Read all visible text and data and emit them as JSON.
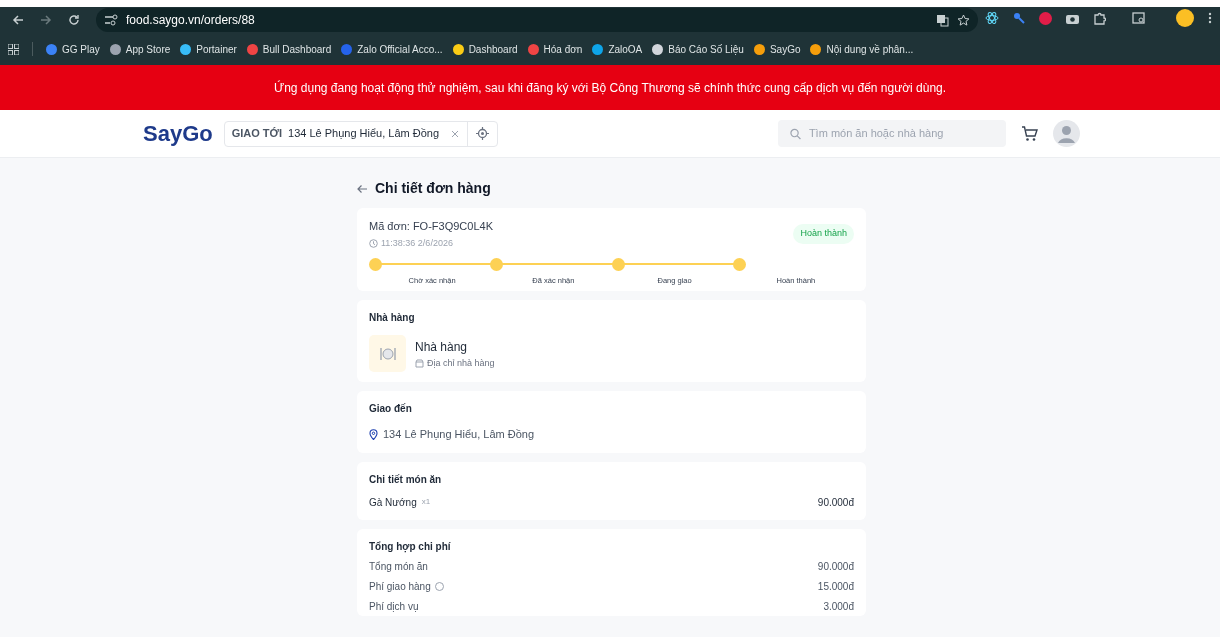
{
  "browser": {
    "url": "food.saygo.vn/orders/88",
    "bookmarks": [
      {
        "label": "GG Play",
        "color": "#3b82f6"
      },
      {
        "label": "App Store",
        "color": "#9ca3af"
      },
      {
        "label": "Portainer",
        "color": "#38bdf8"
      },
      {
        "label": "Bull Dashboard",
        "color": "#ef4444"
      },
      {
        "label": "Zalo Official Acco...",
        "color": "#2563eb"
      },
      {
        "label": "Dashboard",
        "color": "#facc15"
      },
      {
        "label": "Hóa đơn",
        "color": "#ef4444"
      },
      {
        "label": "ZaloOA",
        "color": "#0ea5e9"
      },
      {
        "label": "Báo Cáo Số Liệu",
        "color": "#d1d5db"
      },
      {
        "label": "SayGo",
        "color": "#f59e0b"
      },
      {
        "label": "Nội dung về phân...",
        "color": "#f59e0b"
      }
    ]
  },
  "banner": "Ứng dụng đang hoạt động thử nghiệm, sau khi đăng ký với Bộ Công Thương sẽ chính thức cung cấp dịch vụ đến người dùng.",
  "header": {
    "logo": "SayGo",
    "deliver_label": "GIAO TỚI",
    "address": "134 Lê Phụng Hiểu, Lâm Đồng",
    "search_placeholder": "Tìm món ăn hoặc nhà hàng"
  },
  "page_title": "Chi tiết đơn hàng",
  "order": {
    "code": "Mã đơn: FO-F3Q9C0L4K",
    "time": "11:38:36 2/6/2026",
    "status": "Hoàn thành",
    "steps": [
      {
        "label": "Chờ xác nhận",
        "done": true
      },
      {
        "label": "Đã xác nhận",
        "done": true
      },
      {
        "label": "Đang giao",
        "done": true
      },
      {
        "label": "Hoàn thành",
        "done": true
      }
    ]
  },
  "restaurant": {
    "heading": "Nhà hàng",
    "name": "Nhà hàng",
    "address": "Địa chỉ nhà hàng"
  },
  "delivery": {
    "heading": "Giao đến",
    "address": "134 Lê Phụng Hiểu, Lâm Đồng"
  },
  "items": {
    "heading": "Chi tiết món ăn",
    "rows": [
      {
        "name": "Gà Nướng",
        "qty": "x1",
        "price": "90.000đ"
      }
    ]
  },
  "costs": {
    "heading": "Tổng hợp chi phí",
    "rows": [
      {
        "label": "Tổng món ăn",
        "value": "90.000đ",
        "info": false
      },
      {
        "label": "Phí giao hàng",
        "value": "15.000đ",
        "info": true
      },
      {
        "label": "Phí dịch vụ",
        "value": "3.000đ",
        "info": false
      }
    ]
  }
}
